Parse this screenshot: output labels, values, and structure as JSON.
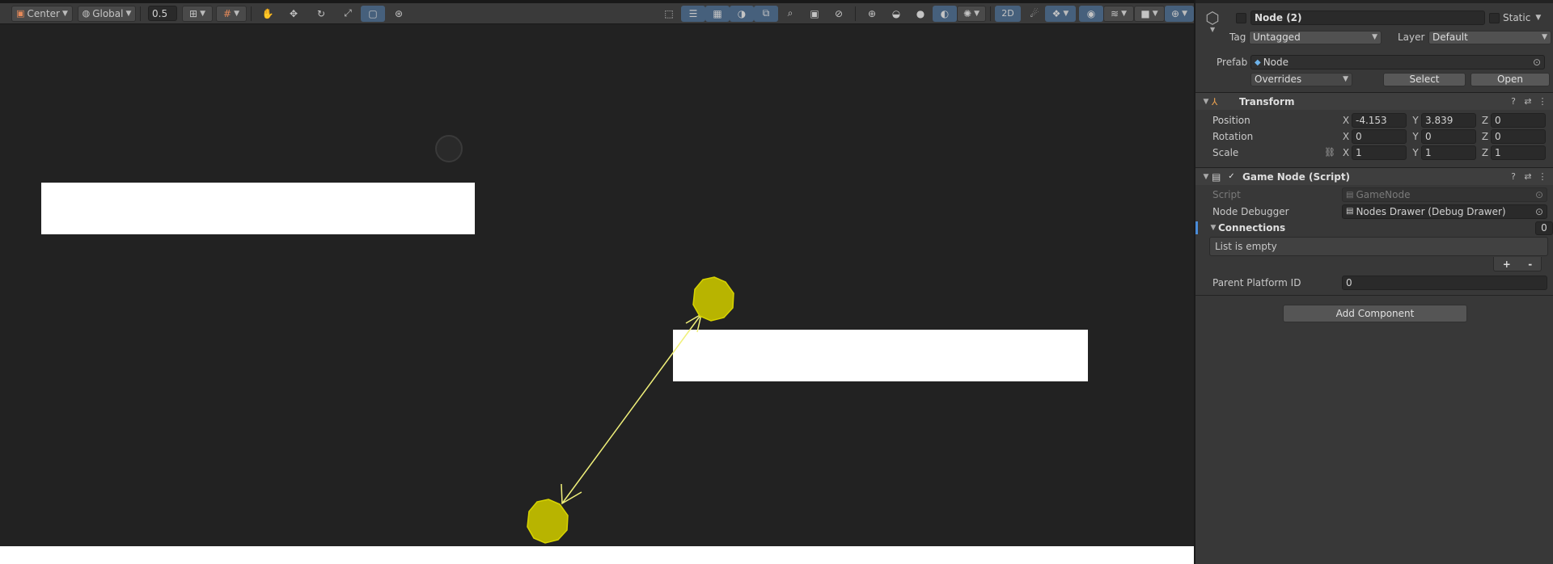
{
  "toolbar": {
    "pivot_mode": "Center",
    "pivot_rotation": "Global",
    "grid_snap_value": "0.5",
    "btn_2d": "2D"
  },
  "inspector": {
    "object_name": "Node (2)",
    "static_label": "Static",
    "tag_label": "Tag",
    "tag_value": "Untagged",
    "layer_label": "Layer",
    "layer_value": "Default",
    "prefab_label": "Prefab",
    "prefab_value": "Node",
    "overrides_label": "Overrides",
    "select_label": "Select",
    "open_label": "Open",
    "transform": {
      "title": "Transform",
      "position_label": "Position",
      "rotation_label": "Rotation",
      "scale_label": "Scale",
      "position": {
        "x": "-4.153",
        "y": "3.839",
        "z": "0"
      },
      "rotation": {
        "x": "0",
        "y": "0",
        "z": "0"
      },
      "scale": {
        "x": "1",
        "y": "1",
        "z": "1"
      },
      "axis_x": "X",
      "axis_y": "Y",
      "axis_z": "Z"
    },
    "game_node": {
      "title": "Game Node (Script)",
      "script_label": "Script",
      "script_value": "GameNode",
      "debugger_label": "Node Debugger",
      "debugger_value": "Nodes Drawer (Debug Drawer)",
      "connections_label": "Connections",
      "connections_count": "0",
      "list_empty": "List is empty",
      "add_symbol": "+",
      "remove_symbol": "-",
      "parent_platform_label": "Parent Platform ID",
      "parent_platform_value": "0"
    },
    "add_component_label": "Add Component"
  },
  "colors": {
    "node_fill": "#b8b400",
    "node_edge": "#d8d400",
    "connection_line": "#f0f07a",
    "platform": "#ffffff",
    "scene_bg": "#222222"
  }
}
